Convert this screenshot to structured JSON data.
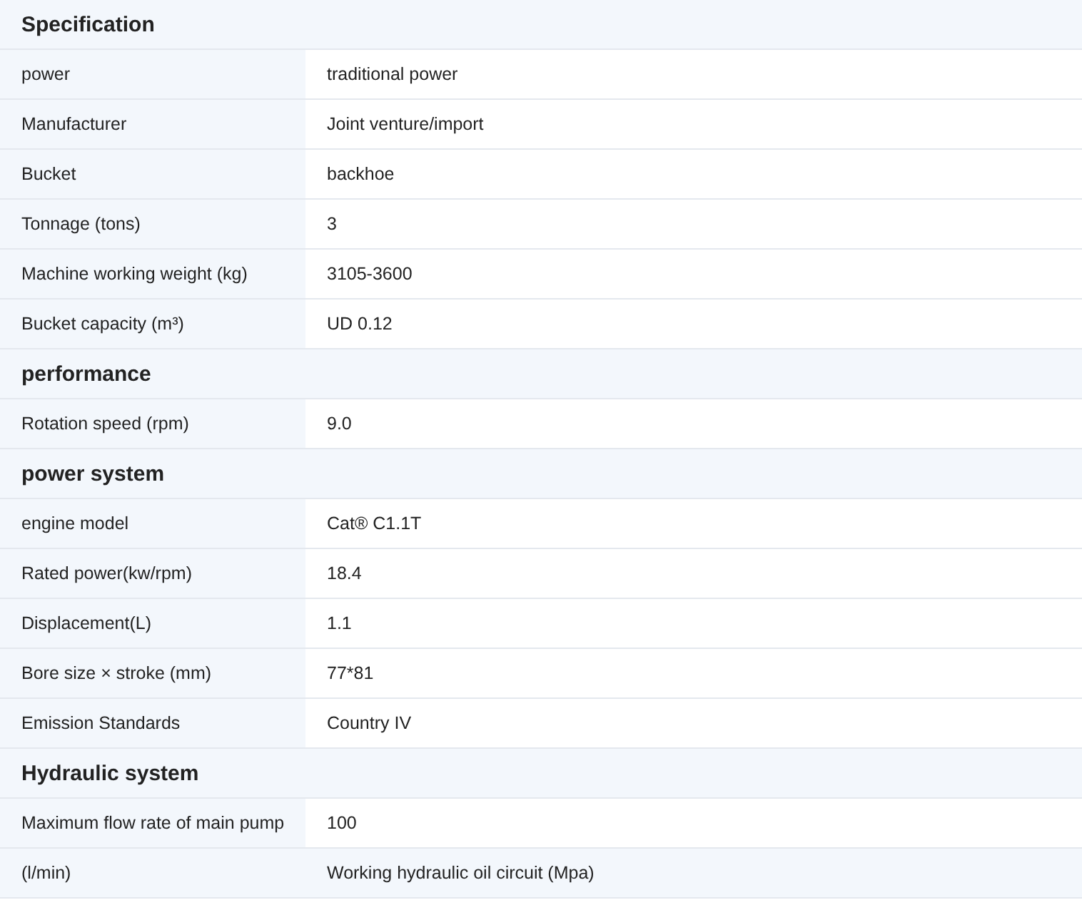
{
  "sections": [
    {
      "title": "Specification",
      "rows": [
        {
          "label": "power",
          "value": "traditional power",
          "highlighted": false
        },
        {
          "label": "Manufacturer",
          "value": "Joint venture/import",
          "highlighted": false
        },
        {
          "label": "Bucket",
          "value": "backhoe",
          "highlighted": false
        },
        {
          "label": "Tonnage (tons)",
          "value": "3",
          "highlighted": false
        },
        {
          "label": "Machine working weight (kg)",
          "value": "3105-3600",
          "highlighted": false
        },
        {
          "label": "Bucket capacity (m³)",
          "value": "UD 0.12",
          "highlighted": false
        }
      ]
    },
    {
      "title": "performance",
      "rows": [
        {
          "label": "Rotation speed (rpm)",
          "value": "9.0",
          "highlighted": false
        }
      ]
    },
    {
      "title": "power system",
      "rows": [
        {
          "label": "engine model",
          "value": "Cat® C1.1T",
          "highlighted": false
        },
        {
          "label": "Rated power(kw/rpm)",
          "value": "18.4",
          "highlighted": false
        },
        {
          "label": "Displacement(L)",
          "value": "1.1",
          "highlighted": false
        },
        {
          "label": "Bore size × stroke (mm)",
          "value": "77*81",
          "highlighted": false
        },
        {
          "label": "Emission Standards",
          "value": "Country IV",
          "highlighted": false
        }
      ]
    },
    {
      "title": "Hydraulic system",
      "rows": [
        {
          "label": "Maximum flow rate of main pump",
          "value": "100",
          "highlighted": false
        },
        {
          "label": "(l/min)",
          "value": "Working hydraulic oil circuit (Mpa)",
          "highlighted": true
        }
      ]
    }
  ]
}
